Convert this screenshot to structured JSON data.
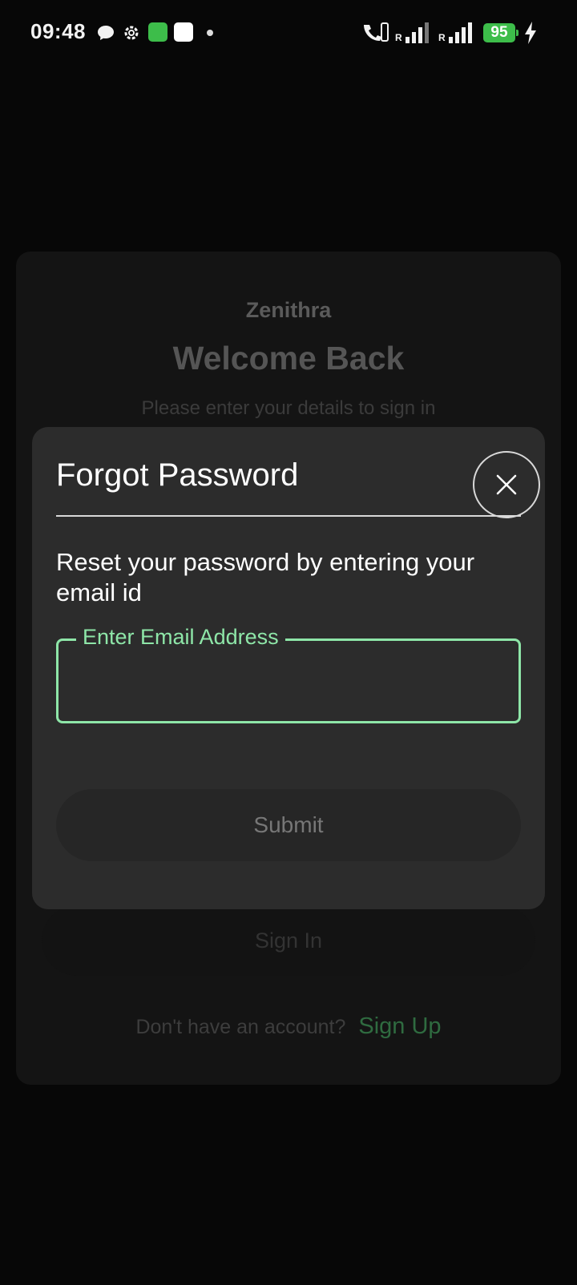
{
  "status_bar": {
    "time": "09:48",
    "battery": "95",
    "signal_roaming_1": "R",
    "signal_roaming_2": "R",
    "icons": [
      "chat-icon",
      "settings-icon",
      "app-icon",
      "app-icon-2",
      "notification-dot",
      "wifi-calling-icon",
      "signal-icon",
      "signal-icon-2",
      "charging-icon"
    ],
    "battery_color": "#3dbd4a"
  },
  "login": {
    "brand": "Zenithra",
    "title": "Welcome Back",
    "subtitle": "Please enter your details to sign in",
    "sign_in_label": "Sign In",
    "signup_question": "Don't have an account?",
    "signup_link": "Sign Up"
  },
  "dialog": {
    "title": "Forgot Password",
    "description": "Reset your password by entering your email id",
    "email_label": "Enter Email Address",
    "email_value": "",
    "submit_label": "Submit",
    "accent_color": "#8ee6a8"
  }
}
